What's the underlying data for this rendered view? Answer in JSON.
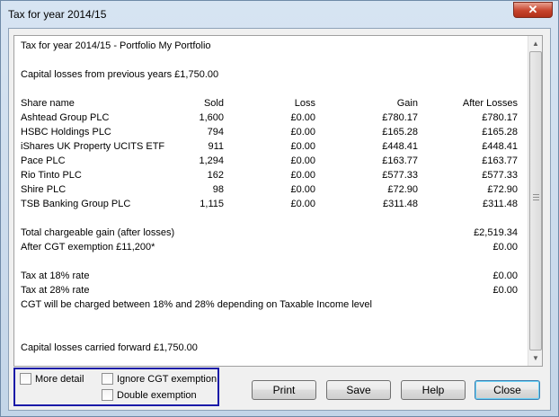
{
  "window": {
    "title": "Tax for year 2014/15",
    "close_glyph": "✕"
  },
  "report": {
    "heading": "Tax for year 2014/15  -  Portfolio My Portfolio",
    "previous_losses": "Capital losses from previous years £1,750.00",
    "headers": {
      "share": "Share name",
      "sold": "Sold",
      "loss": "Loss",
      "gain": "Gain",
      "after": "After Losses"
    },
    "rows": [
      {
        "share": "Ashtead Group PLC",
        "sold": "1,600",
        "loss": "£0.00",
        "gain": "£780.17",
        "after": "£780.17"
      },
      {
        "share": "HSBC Holdings PLC",
        "sold": "794",
        "loss": "£0.00",
        "gain": "£165.28",
        "after": "£165.28"
      },
      {
        "share": "iShares UK Property UCITS ETF",
        "sold": "911",
        "loss": "£0.00",
        "gain": "£448.41",
        "after": "£448.41"
      },
      {
        "share": "Pace PLC",
        "sold": "1,294",
        "loss": "£0.00",
        "gain": "£163.77",
        "after": "£163.77"
      },
      {
        "share": "Rio Tinto PLC",
        "sold": "162",
        "loss": "£0.00",
        "gain": "£577.33",
        "after": "£577.33"
      },
      {
        "share": "Shire PLC",
        "sold": "98",
        "loss": "£0.00",
        "gain": "£72.90",
        "after": "£72.90"
      },
      {
        "share": "TSB Banking Group PLC",
        "sold": "1,115",
        "loss": "£0.00",
        "gain": "£311.48",
        "after": "£311.48"
      }
    ],
    "total_label": "Total chargeable gain (after losses)",
    "total_value": "£2,519.34",
    "exemption_label": "After CGT exemption £11,200*",
    "exemption_value": "£0.00",
    "tax18_label": "Tax at 18% rate",
    "tax18_value": "£0.00",
    "tax28_label": "Tax at 28% rate",
    "tax28_value": "£0.00",
    "cgt_note": "CGT will be charged between 18% and 28% depending on Taxable Income level",
    "carried_forward": "Capital losses carried forward £1,750.00"
  },
  "options": {
    "more_detail": {
      "label": "More detail",
      "checked": false
    },
    "ignore_cgt": {
      "label": "Ignore CGT exemption",
      "checked": false
    },
    "double_exemption": {
      "label": "Double exemption",
      "checked": false
    }
  },
  "buttons": {
    "print": "Print",
    "save": "Save",
    "help": "Help",
    "close": "Close"
  },
  "icons": {
    "scroll_up": "up-arrow-icon",
    "scroll_down": "down-arrow-icon"
  },
  "colors": {
    "options_border": "#1a1aa8",
    "close_button_red": "#c7442c",
    "default_button_glow": "#6bd0f4"
  }
}
